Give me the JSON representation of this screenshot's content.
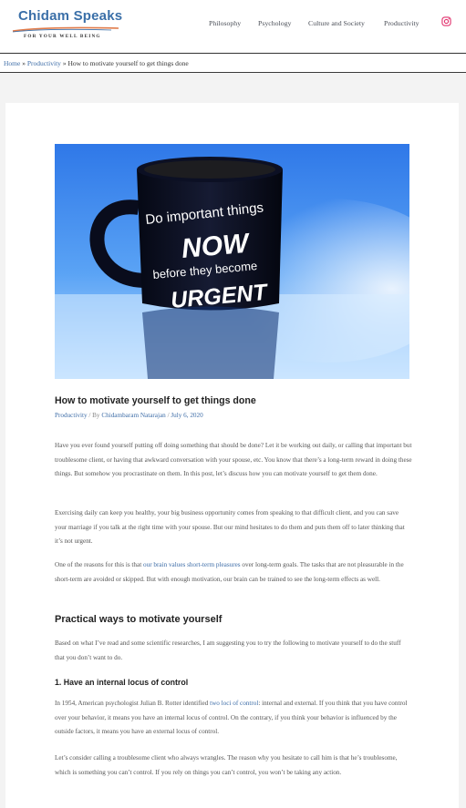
{
  "header": {
    "logo_title": "Chidam Speaks",
    "logo_tagline": "FOR YOUR WELL BEING",
    "nav": [
      {
        "label": "Philosophy"
      },
      {
        "label": "Psychology"
      },
      {
        "label": "Culture and Society"
      },
      {
        "label": "Productivity"
      }
    ],
    "social_icon": "instagram-icon",
    "colors": {
      "brand": "#3a6fa8",
      "swoosh": "#e07b4a",
      "instagram": "#e1306c"
    }
  },
  "breadcrumb": {
    "home": "Home",
    "sep1": "»",
    "category": "Productivity",
    "sep2": "»",
    "current": "How to motivate yourself to get things done"
  },
  "hero": {
    "mug_lines": [
      "Do important things",
      "NOW",
      "before they become",
      "URGENT"
    ]
  },
  "article": {
    "title": "How to motivate yourself to get things done",
    "meta": {
      "category": "Productivity",
      "sep": "/ By",
      "author": "Chidambaram Natarajan",
      "sep2": "/",
      "date": "July 6, 2020"
    },
    "p1": "Have you ever found yourself putting off doing something that should be done? Let it be working out daily, or calling that important but troublesome client, or having that awkward conversation with your spouse, etc. You know that there’s a long-term reward in doing these things. But somehow you procrastinate on them. In this post, let’s discuss how you can motivate yourself to get them done.",
    "p2": "Exercising daily can keep you healthy, your big business opportunity comes from speaking to that difficult client, and you can save your marriage if you talk at the right time with your spouse. But our mind hesitates to do them and puts them off to later thinking that it’s not urgent.",
    "p3_before": "One of the reasons for this is that ",
    "p3_link": "our brain values short-term pleasures",
    "p3_after": " over long-term goals. The tasks that are not pleasurable in the short-term are avoided or skipped. But with enough motivation, our brain can be trained to see the long-term effects as well.",
    "h2": "Practical ways to motivate yourself",
    "p4": "Based on what I’ve read and some scientific researches, I am suggesting you to try the following to motivate yourself to do the stuff that you don’t want to do.",
    "h3": "1. Have an internal locus of control",
    "p5_before": "In 1954, American psychologist Julian B. Rotter identified ",
    "p5_link": "two loci of control",
    "p5_after": ": internal and external. If you think that you have control over your behavior, it means you have an internal locus of control. On the contrary, if you think your behavior is influenced by the outside factors, it means you have an external locus of control.",
    "p6": "Let’s consider calling a troublesome client who always wrangles. The reason why you hesitate to call him is that he’s troublesome, which is something you can’t control. If you rely on things you can’t control, you won’t be taking any action."
  }
}
